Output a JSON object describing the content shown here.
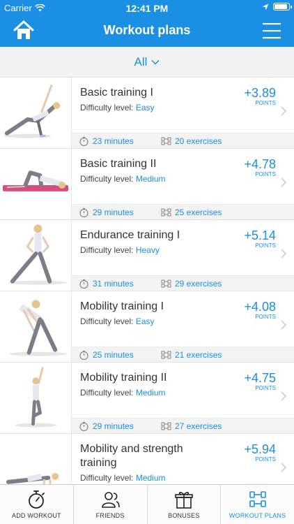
{
  "status_bar": {
    "carrier": "Carrier",
    "time": "12:41 PM",
    "battery_level": 0.9
  },
  "header": {
    "title": "Workout plans"
  },
  "filter": {
    "selected": "All"
  },
  "workouts": [
    {
      "name": "Basic training I",
      "difficulty_label": "Difficulty level:",
      "difficulty": "Easy",
      "points": "+3.89",
      "points_unit": "POINTS",
      "duration": "23 minutes",
      "exercises": "20 exercises",
      "pose": "side-plank"
    },
    {
      "name": "Basic training II",
      "difficulty_label": "Difficulty level:",
      "difficulty": "Medium",
      "points": "+4.78",
      "points_unit": "POINTS",
      "duration": "29 minutes",
      "exercises": "25 exercises",
      "pose": "bridge"
    },
    {
      "name": "Endurance training I",
      "difficulty_label": "Difficulty level:",
      "difficulty": "Heavy",
      "points": "+5.14",
      "points_unit": "POINTS",
      "duration": "31 minutes",
      "exercises": "29 exercises",
      "pose": "side-lunge"
    },
    {
      "name": "Mobility training I",
      "difficulty_label": "Difficulty level:",
      "difficulty": "Easy",
      "points": "+4.08",
      "points_unit": "POINTS",
      "duration": "25 minutes",
      "exercises": "21 exercises",
      "pose": "forward-bend"
    },
    {
      "name": "Mobility training II",
      "difficulty_label": "Difficulty level:",
      "difficulty": "Medium",
      "points": "+4.75",
      "points_unit": "POINTS",
      "duration": "29 minutes",
      "exercises": "27 exercises",
      "pose": "standing-stretch"
    },
    {
      "name": "Mobility and strength training",
      "difficulty_label": "Difficulty level:",
      "difficulty": "Medium",
      "points": "+5.94",
      "points_unit": "POINTS",
      "pose": "push-up"
    }
  ],
  "tabs": [
    {
      "label": "ADD WORKOUT",
      "icon": "stopwatch-icon"
    },
    {
      "label": "FRIENDS",
      "icon": "friends-icon"
    },
    {
      "label": "BONUSES",
      "icon": "gift-icon"
    },
    {
      "label": "WORKOUT PLANS",
      "icon": "dumbbells-icon"
    }
  ],
  "colors": {
    "accent": "#1a8fe3",
    "header_bg": "#1a8fe3",
    "filter_bg": "#f2f2f2",
    "meta_bg": "#f3f3f3"
  }
}
